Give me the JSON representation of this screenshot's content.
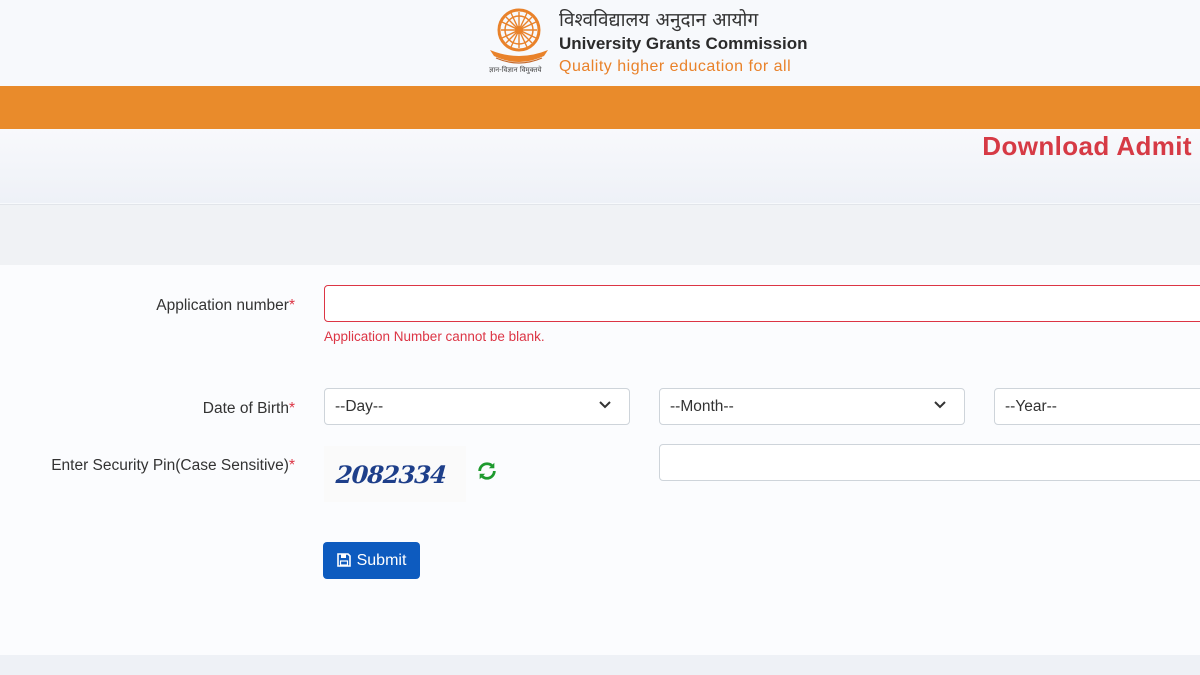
{
  "header": {
    "org_name_hindi": "विश्वविद्यालय अनुदान आयोग",
    "org_name": "University Grants Commission",
    "tagline": "Quality higher education for all",
    "logo_caption_hindi": "ज्ञान-विज्ञान विमुक्तये"
  },
  "page": {
    "title": "Download Admit"
  },
  "form": {
    "application_number": {
      "label": "Application number",
      "required_mark": "*",
      "value": "",
      "error": "Application Number cannot be blank."
    },
    "dob": {
      "label": "Date of Birth",
      "required_mark": "*",
      "day_placeholder": "--Day--",
      "month_placeholder": "--Month--",
      "year_placeholder": "--Year--"
    },
    "security_pin": {
      "label": "Enter Security Pin(Case Sensitive)",
      "required_mark": "*",
      "captcha_text": "2082334",
      "value": ""
    },
    "submit_label": "Submit"
  },
  "icons": {
    "refresh": "refresh-icon",
    "submit": "save-icon",
    "dropdown": "chevron-down-icon"
  },
  "colors": {
    "brand_orange": "#e98b2b",
    "title_red": "#d63a45",
    "error_red": "#dc3545",
    "button_blue": "#0d5bbf",
    "refresh_green": "#1e9a2e"
  }
}
